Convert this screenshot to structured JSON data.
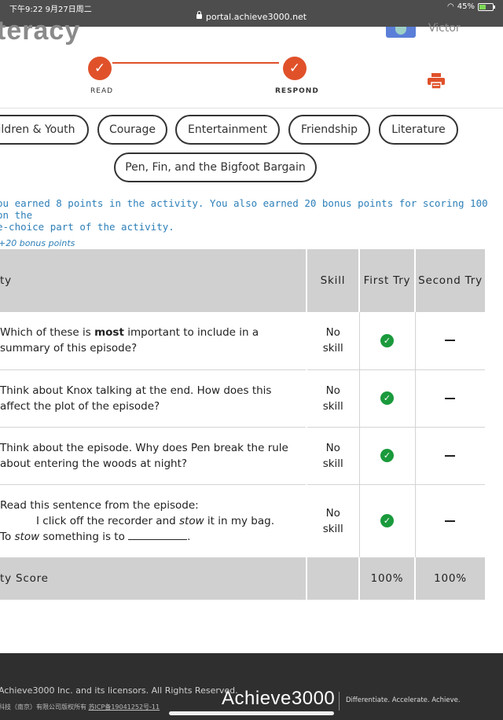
{
  "status_bar": {
    "time": "下午9:22  9月27日周二",
    "url": "portal.achieve3000.net",
    "battery": "45%"
  },
  "header": {
    "logo_text": "teracy",
    "user_name": "Victor",
    "steps": [
      {
        "label": "READ",
        "completed": true
      },
      {
        "label": "RESPOND",
        "completed": true
      }
    ],
    "icons": {
      "print": "printer-icon",
      "step": "check-icon"
    }
  },
  "tags": [
    "ildren & Youth",
    "Courage",
    "Entertainment",
    "Friendship",
    "Literature",
    "Pen, Fin, and the Bigfoot Bargain"
  ],
  "messages": {
    "earned_line1": "ou earned 8 points in the activity. You also earned 20 bonus points for scoring 100 on the",
    "earned_line2": "e-choice part of the activity.",
    "bonus": "+20 bonus points"
  },
  "table": {
    "headers": {
      "activity": "ty",
      "skill": "Skill",
      "first_try": "First Try",
      "second_try": "Second Try"
    },
    "rows": [
      {
        "question_line1": "Which of these is ",
        "question_bold": "most",
        "question_line1_end": " important to include in a",
        "question_line2": "summary of this episode?",
        "skill": "No skill",
        "first": "check",
        "second": "dash"
      },
      {
        "question_line1": "Think about Knox talking at the end. How does this",
        "question_line2": "affect the plot of the episode?",
        "skill": "No skill",
        "first": "check",
        "second": "dash"
      },
      {
        "question_line1": "Think about the episode. Why does Pen break the rule",
        "question_line2": "about entering the woods at night?",
        "skill": "No skill",
        "first": "check",
        "second": "dash"
      },
      {
        "question_line1": "Read this sentence from the episode:",
        "question_quote_a": "I click off the recorder and ",
        "question_quote_italic": "stow",
        "question_quote_b": " it in my bag.",
        "question_line3_a": "To ",
        "question_line3_italic": "stow",
        "question_line3_b": " something is to",
        "question_line3_end": ".",
        "skill": "No skill",
        "first": "check",
        "second": "dash"
      }
    ],
    "footer": {
      "label": "ty Score",
      "skill": "",
      "first": "100%",
      "second": "100%"
    }
  },
  "footer": {
    "copyright": "Achieve3000 Inc. and its licensors. All Rights Reserved.",
    "icp_a": "科技（南京）有限公司版权所有 ",
    "icp_link": "苏ICP备19041252号-11",
    "brand": "Achieve3000",
    "tagline": "Differentiate. Accelerate. Achieve."
  },
  "colors": {
    "accent": "#e0512a",
    "info": "#2d7fb8",
    "success": "#1a9a3c",
    "footer_bg": "#2f2f2f"
  }
}
